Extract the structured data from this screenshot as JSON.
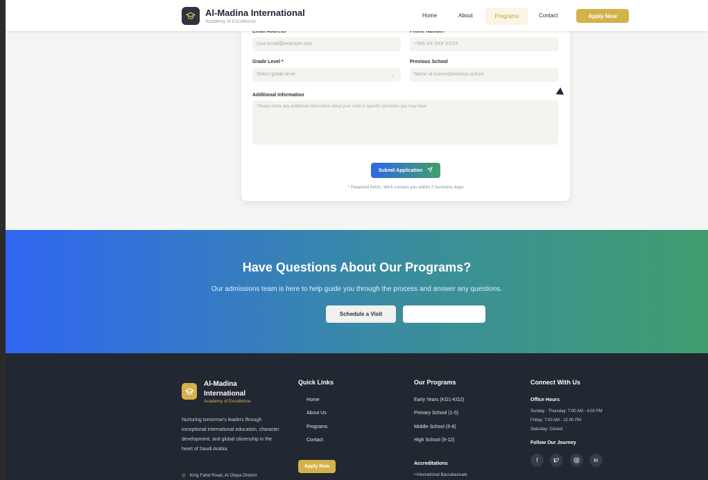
{
  "header": {
    "brand_name": "Al-Madina International",
    "brand_sub": "Academy of Excellence",
    "nav": [
      "Home",
      "About",
      "Programs",
      "Contact"
    ],
    "apply_label": "Apply Now"
  },
  "form": {
    "email_label": "Email Address *",
    "email_placeholder": "your.email@example.com",
    "phone_label": "Phone Number *",
    "phone_placeholder": "+966 XX XXX XXXX",
    "grade_label": "Grade Level *",
    "grade_placeholder": "Select grade level",
    "school_label": "Previous School",
    "school_placeholder": "Name of current/previous school",
    "info_label": "Additional Information",
    "info_placeholder": "Please share any additional information about your child or specific questions you may have",
    "submit_label": "Submit Application",
    "required_note": "* Required fields. We'll contact you within 2 business days"
  },
  "cta": {
    "title": "Have Questions About Our Programs?",
    "subtitle": "Our admissions team is here to help guide you through the process and answer any questions.",
    "schedule_label": "Schedule a Visit",
    "second_label": ""
  },
  "footer": {
    "brand_name": "Al-Madina International",
    "brand_sub": "Academy of Excellence",
    "description": "Nurturing tomorrow's leaders through exceptional international education, character development, and global citizenship in the heart of Saudi Arabia.",
    "address": "King Fahd Road, Al Olaya District",
    "quick_links_title": "Quick Links",
    "quick_links": [
      "Home",
      "About Us",
      "Programs",
      "Contact"
    ],
    "apply_label": "Apply Now",
    "programs_title": "Our Programs",
    "programs": [
      "Early Years (KG1-KG2)",
      "Primary School (1-5)",
      "Middle School (6-8)",
      "High School (9-12)"
    ],
    "accreditations_title": "Accreditations",
    "accreditation_item": "• International Baccalaureate",
    "connect_title": "Connect With Us",
    "office_hours_title": "Office Hours",
    "office_hours": [
      "Sunday - Thursday: 7:00 AM - 4:00 PM",
      "Friday: 7:00 AM - 12:00 PM",
      "Saturday: Closed"
    ],
    "follow_title": "Follow Our Journey",
    "social_icons": [
      "facebook-icon",
      "twitter-icon",
      "instagram-icon",
      "linkedin-icon"
    ]
  },
  "colors": {
    "gold": "#d4b24a",
    "dark": "#222831",
    "blue": "#2f66f0",
    "green": "#3f9d6e"
  }
}
